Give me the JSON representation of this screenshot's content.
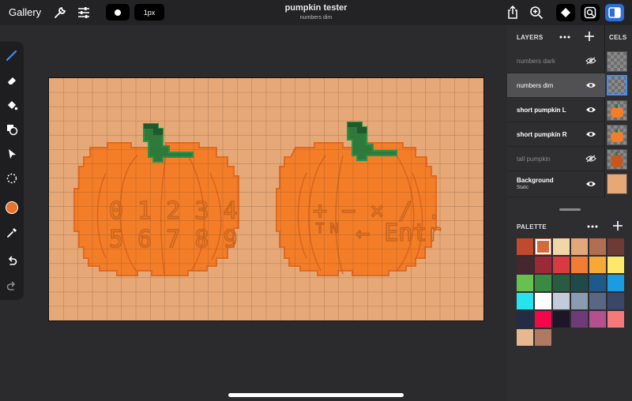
{
  "header": {
    "gallery_label": "Gallery",
    "title": "pumpkin tester",
    "subtitle": "numbers dim",
    "brush_size_label": "1px"
  },
  "toolbar": {
    "tools": [
      "pencil-icon",
      "eraser-icon",
      "fill-bucket-icon",
      "shapes-icon",
      "select-arrow-icon",
      "lasso-icon",
      "current-color-swatch",
      "eyedropper-icon",
      "undo-icon",
      "redo-icon"
    ],
    "current_color": "#e8732c"
  },
  "layers_panel": {
    "heading": "LAYERS",
    "cels_heading": "CELS",
    "layers": [
      {
        "name": "numbers dark",
        "visible": false,
        "selected": false
      },
      {
        "name": "numbers dim",
        "visible": true,
        "selected": true
      },
      {
        "name": "short pumpkin L",
        "visible": true,
        "selected": false
      },
      {
        "name": "short pumpkin R",
        "visible": true,
        "selected": false
      },
      {
        "name": "tall pumpkin",
        "visible": false,
        "selected": false
      },
      {
        "name": "Background",
        "sub": "Static",
        "visible": true,
        "selected": false
      }
    ]
  },
  "palette_panel": {
    "heading": "PALETTE",
    "colors": [
      "#bf4a2e",
      "#d46b3c",
      "#f0d6a8",
      "#e3a77c",
      "#b06e52",
      "#6e3a35",
      "#44282d",
      "#9b2a36",
      "#d93a3f",
      "#f27c33",
      "#f7a935",
      "#fde86a",
      "#67c14e",
      "#3b8a43",
      "#285b3f",
      "#1f4a48",
      "#1d5a8a",
      "#1a9de0",
      "#27e3ee",
      "#ffffff",
      "#c1cbd9",
      "#8b9bb0",
      "#5a6784",
      "#3b4766",
      "#242c45",
      "#f3074a",
      "#1c1628",
      "#6f3a78",
      "#b5508e",
      "#f47a7a",
      "#e7b78f",
      "#b07a62"
    ],
    "selected_index": 1
  },
  "canvas": {
    "background_color": "#e6a877",
    "pumpkin_color": "#f47d27",
    "pumpkin_outline": "#e06a22",
    "stem_color": "#2d7a3a",
    "stem_dark": "#1e5a2c",
    "left_glyph_rows": [
      "0 1 2 3 4",
      "5 6 7 8 9"
    ],
    "right_glyph_rows": [
      "+ − × ∕ .",
      "ᵀᴺ ← Entr"
    ]
  }
}
